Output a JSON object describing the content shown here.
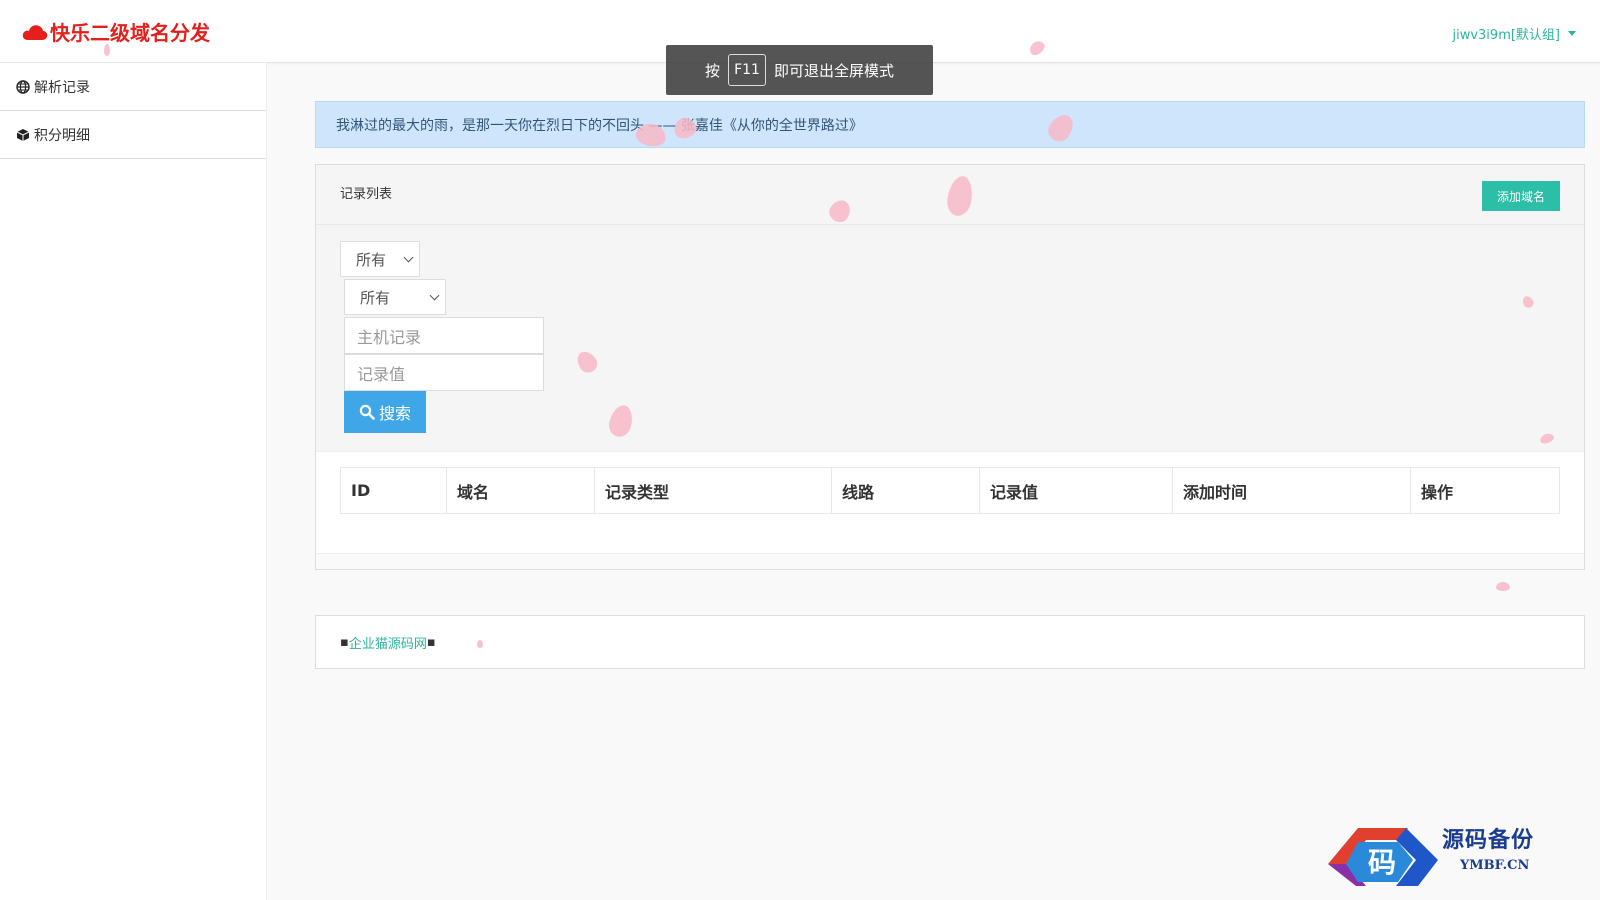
{
  "brand": {
    "title": "快乐二级域名分发",
    "brand_color": "#e3201b"
  },
  "user_menu": {
    "label": "jiwv3i9m[默认组]",
    "icon": "caret-down-icon"
  },
  "fullscreen_toast": {
    "prefix": "按",
    "key": "F11",
    "suffix": "即可退出全屏模式"
  },
  "sidebar": {
    "items": [
      {
        "label": "解析记录",
        "icon": "globe-icon"
      },
      {
        "label": "积分明细",
        "icon": "cube-icon"
      }
    ]
  },
  "notice": {
    "text": "我淋过的最大的雨，是那一天你在烈日下的不回头 —— 张嘉佳《从你的全世界路过》"
  },
  "records_panel": {
    "title": "记录列表",
    "add_button": "添加域名",
    "filters": {
      "select_1_value": "所有",
      "select_2_value": "所有",
      "host_placeholder": "主机记录",
      "value_placeholder": "记录值",
      "search_button": "搜索"
    },
    "table": {
      "columns": [
        "ID",
        "域名",
        "记录类型",
        "线路",
        "记录值",
        "添加时间",
        "操作"
      ],
      "rows": []
    }
  },
  "footer": {
    "link": "企业猫源码网",
    "bullet": "▪"
  },
  "watermark": {
    "title": "源码备份",
    "domain": "YMBF.CN",
    "logo_char": "码"
  },
  "colors": {
    "accent": "#2cbea6",
    "search_btn": "#3fa7e8",
    "notice_bg": "#cfe5fb"
  }
}
